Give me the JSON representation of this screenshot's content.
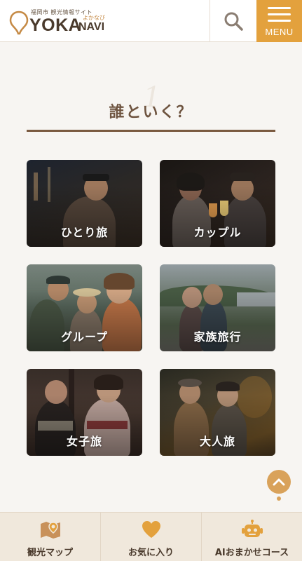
{
  "header": {
    "logo_sub": "福岡市 観光情報サイト",
    "logo_main": "YOKA",
    "logo_navi": "NAVI",
    "logo_ruby": "よかなび",
    "search_icon": "search-icon",
    "menu_label": "MENU"
  },
  "section": {
    "number": "1",
    "title": "誰といく？"
  },
  "cards": [
    {
      "label": "ひとり旅"
    },
    {
      "label": "カップル"
    },
    {
      "label": "グループ"
    },
    {
      "label": "家族旅行"
    },
    {
      "label": "女子旅"
    },
    {
      "label": "大人旅"
    }
  ],
  "bottom_nav": [
    {
      "label": "観光マップ",
      "icon": "map-pin-icon"
    },
    {
      "label": "お気に入り",
      "icon": "heart-icon"
    },
    {
      "label": "AIおまかせコース",
      "icon": "robot-icon"
    }
  ],
  "colors": {
    "accent": "#e3a13d",
    "brown": "#6e5440",
    "background": "#f7f5f2"
  }
}
